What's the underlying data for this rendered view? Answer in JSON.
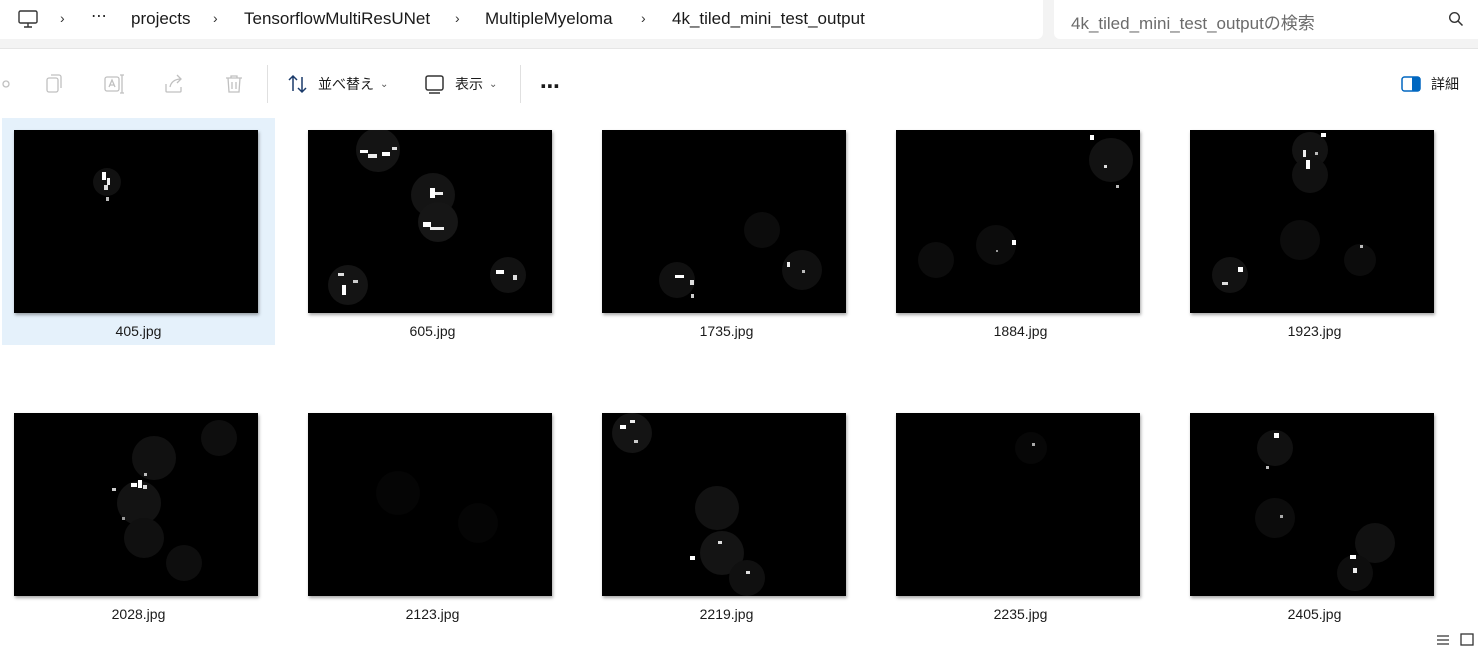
{
  "address": {
    "more": "⋯",
    "crumbs": [
      "projects",
      "TensorflowMultiResUNet",
      "MultipleMyeloma",
      "4k_tiled_mini_test_output"
    ]
  },
  "search": {
    "placeholder": "4k_tiled_mini_test_outputの検索"
  },
  "toolbar": {
    "sort_label": "並べ替え",
    "view_label": "表示",
    "more_label": "⋯",
    "details_label": "詳細"
  },
  "files": [
    {
      "name": "405.jpg",
      "selected": true
    },
    {
      "name": "605.jpg"
    },
    {
      "name": "1735.jpg"
    },
    {
      "name": "1884.jpg"
    },
    {
      "name": "1923.jpg"
    },
    {
      "name": "2028.jpg"
    },
    {
      "name": "2123.jpg"
    },
    {
      "name": "2219.jpg"
    },
    {
      "name": "2235.jpg"
    },
    {
      "name": "2405.jpg"
    }
  ],
  "colors": {
    "selection": "#e5f1fb",
    "accent": "#0067c0"
  }
}
